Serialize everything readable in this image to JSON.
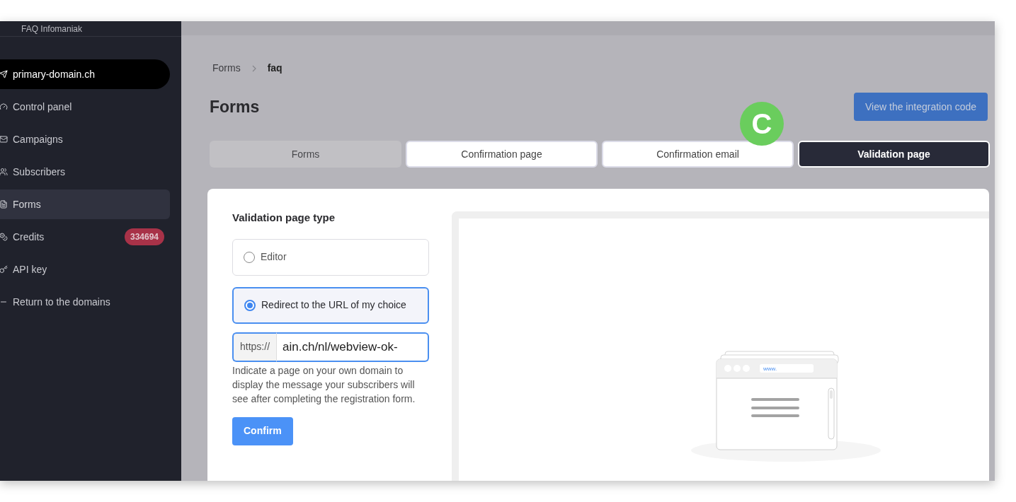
{
  "sidebar": {
    "account": "FAQ Infomaniak",
    "items": [
      {
        "label": "primary-domain.ch",
        "kind": "domain",
        "selected": false
      },
      {
        "label": "Control panel",
        "kind": "link",
        "selected": false
      },
      {
        "label": "Campaigns",
        "kind": "link",
        "selected": false
      },
      {
        "label": "Subscribers",
        "kind": "link",
        "selected": false
      },
      {
        "label": "Forms",
        "kind": "link",
        "selected": true
      },
      {
        "label": "Credits",
        "kind": "link",
        "selected": false,
        "badge": "334694"
      },
      {
        "label": "API key",
        "kind": "link",
        "selected": false
      },
      {
        "label": "Return to the domains",
        "kind": "back",
        "selected": false
      }
    ]
  },
  "breadcrumb": [
    "Forms",
    "faq"
  ],
  "page": {
    "title": "Forms",
    "action": "View the integration code"
  },
  "tabs": [
    {
      "label": "Forms",
      "selected": false,
      "disabled": true
    },
    {
      "label": "Confirmation page",
      "selected": false,
      "disabled": false
    },
    {
      "label": "Confirmation email",
      "selected": false,
      "disabled": false
    },
    {
      "label": "Validation page",
      "selected": true,
      "disabled": false
    }
  ],
  "annotation": {
    "label": "C"
  },
  "settings": {
    "heading": "Validation page type",
    "options": [
      {
        "label": "Editor",
        "selected": false
      },
      {
        "label": "Redirect to the URL of my choice",
        "selected": true
      }
    ],
    "url_field": {
      "prefix": "https://",
      "value": "ain.ch/nl/webview-ok-"
    },
    "help": "Indicate a page on your own domain to display the message your subscribers will see after completing the registration form.",
    "submit": "Confirm"
  },
  "preview": {
    "address": "www."
  }
}
